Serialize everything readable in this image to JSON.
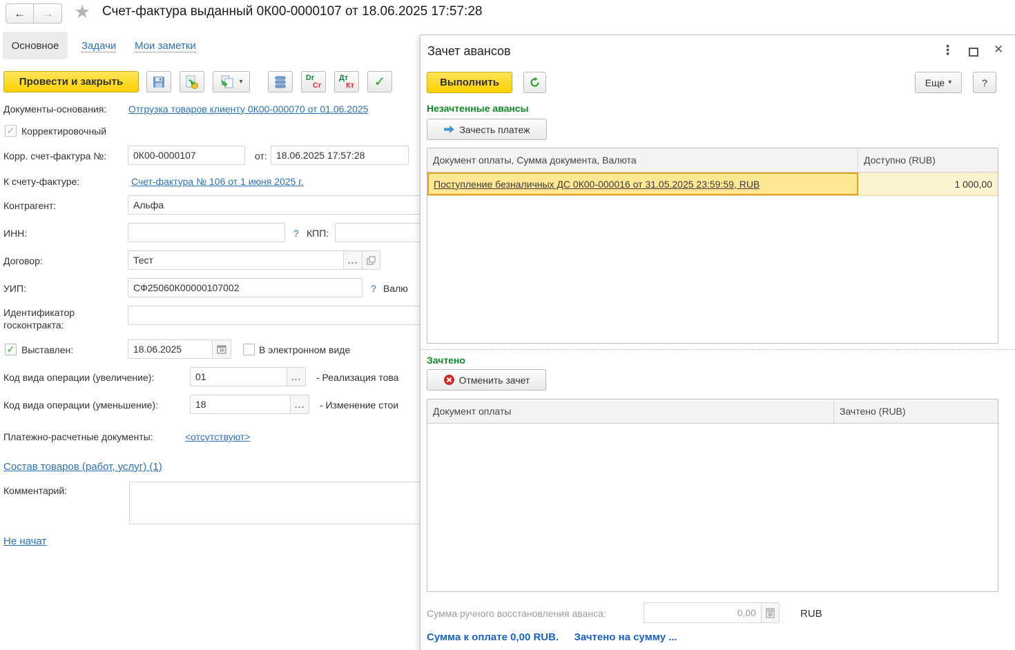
{
  "colors": {
    "accent_yellow": "#fdd000",
    "link_blue": "#2d71b8",
    "green_heading": "#0f8a26",
    "selection_fill": "#ffe794",
    "selection_border": "#e5a11c",
    "footer_blue": "#1b63ba"
  },
  "icons": {
    "back": "←",
    "forward": "→",
    "star": "★",
    "menu_dots": "⋮",
    "close": "✕",
    "caret_down": "▾",
    "check": "✓",
    "help": "?",
    "ellipsis": "..."
  },
  "header": {
    "title": "Счет-фактура выданный 0К00-0000107 от 18.06.2025 17:57:28",
    "tabs": [
      {
        "label": "Основное",
        "active": true
      },
      {
        "label": "Задачи",
        "active": false
      },
      {
        "label": "Мои заметки",
        "active": false
      }
    ]
  },
  "toolbar": {
    "post_and_close": "Провести и закрыть",
    "dr": "Dr",
    "cr": "Cr",
    "dt": "Дт",
    "kt": "Кт"
  },
  "form": {
    "docs_base_label": "Документы-основания:",
    "docs_base_link": "Отгрузка товаров клиенту 0К00-000070 от 01.06.2025",
    "corrective_label": "Корректировочный",
    "corr_number_label": "Корр. счет-фактура №:",
    "corr_number_value": "0К00-0000107",
    "from_label": "от:",
    "corr_date_value": "18.06.2025 17:57:28",
    "to_invoice_label": "К счету-фактуре:",
    "to_invoice_link": "Счет-фактура № 106 от 1 июня 2025 г.",
    "counterparty_label": "Контрагент:",
    "counterparty_value": "Альфа",
    "inn_label": "ИНН:",
    "inn_value": "",
    "help": "?",
    "kpp_label": "КПП:",
    "kpp_value": "",
    "contract_label": "Договор:",
    "contract_value": "Тест",
    "uip_label": "УИП:",
    "uip_value": "СФ25060К00000107002",
    "currency_label_cut": "Валю",
    "gov_contract_label_1": "Идентификатор",
    "gov_contract_label_2": "госконтракта:",
    "gov_contract_value": "",
    "issued_label": "Выставлен:",
    "issued_date_value": "18.06.2025",
    "electronic_label": "В электронном виде",
    "op_inc_label": "Код вида операции (увеличение):",
    "op_inc_value": "01",
    "op_inc_desc": "- Реализация това",
    "op_dec_label": "Код вида операции (уменьшение):",
    "op_dec_value": "18",
    "op_dec_desc": "- Изменение стои",
    "payment_docs_label": "Платежно-расчетные документы:",
    "payment_docs_link": "<отсутствуют>",
    "goods_link": "Состав товаров (работ, услуг) (1)",
    "comment_label": "Комментарий:",
    "comment_value": "",
    "not_started_link": "Не начат"
  },
  "panel": {
    "title": "Зачет авансов",
    "execute": "Выполнить",
    "more": "Еще",
    "help": "?",
    "unoffset_heading": "Незачтенные авансы",
    "offset_payment": "Зачесть платеж",
    "table_unoffset": {
      "col_doc": "Документ оплаты, Сумма документа, Валюта",
      "col_available": "Доступно (RUB)",
      "rows": [
        {
          "doc": "Поступление безналичных ДС 0К00-000016 от 31.05.2025 23:59:59, RUB",
          "available": "1 000,00"
        }
      ]
    },
    "offset_heading": "Зачтено",
    "cancel_offset": "Отменить зачет",
    "table_offset": {
      "col_doc": "Документ оплаты",
      "col_offset": "Зачтено (RUB)"
    },
    "manual_restore_label": "Сумма ручного восстановления аванса:",
    "manual_restore_value": "0,00",
    "currency": "RUB",
    "footer_left": "Сумма к оплате 0,00 RUB.",
    "footer_right": "Зачтено на сумму ..."
  }
}
